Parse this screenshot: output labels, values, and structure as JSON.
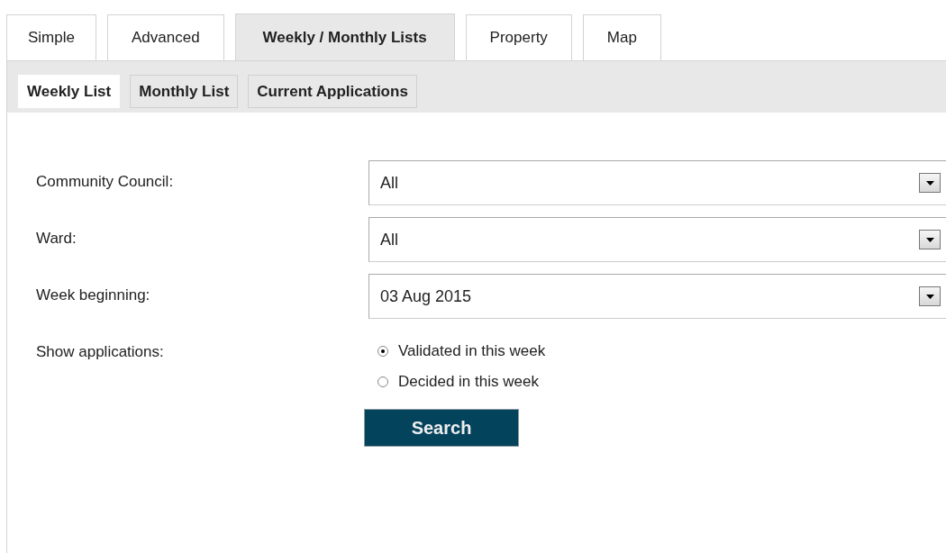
{
  "tabs": [
    {
      "label": "Simple",
      "selected": false
    },
    {
      "label": "Advanced",
      "selected": false
    },
    {
      "label": "Weekly / Monthly Lists",
      "selected": true
    },
    {
      "label": "Property",
      "selected": false
    },
    {
      "label": "Map",
      "selected": false
    }
  ],
  "subtabs": [
    {
      "label": "Weekly List",
      "selected": true
    },
    {
      "label": "Monthly List",
      "selected": false
    },
    {
      "label": "Current Applications",
      "selected": false
    }
  ],
  "fields": [
    {
      "label": "Community Council:",
      "value": "All"
    },
    {
      "label": "Ward:",
      "value": "All"
    },
    {
      "label": "Week beginning:",
      "value": "03 Aug 2015"
    }
  ],
  "show_applications": {
    "label": "Show applications:",
    "options": [
      {
        "label": "Validated in this week",
        "selected": true
      },
      {
        "label": "Decided in this week",
        "selected": false
      }
    ]
  },
  "search_button": "Search"
}
